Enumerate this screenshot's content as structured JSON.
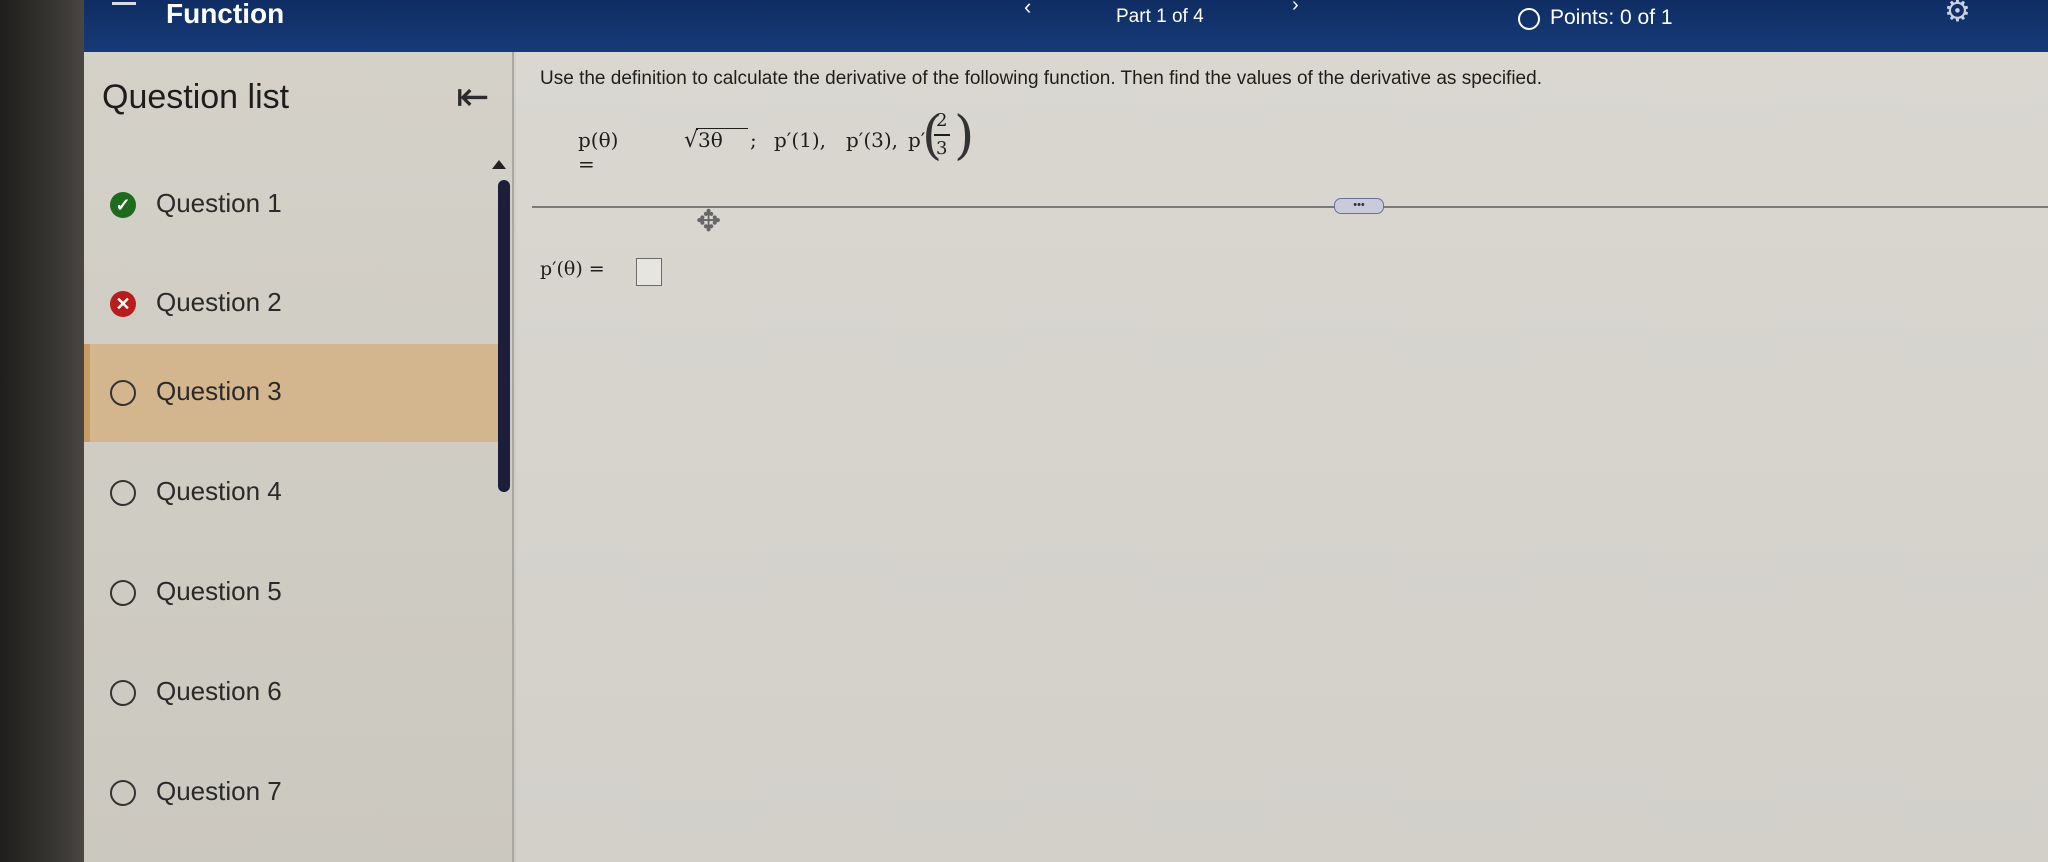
{
  "header": {
    "title": "Function",
    "part": "Part 1 of 4",
    "points": "Points: 0 of 1",
    "prev": "‹",
    "next": "›"
  },
  "sidebar": {
    "title": "Question list",
    "items": [
      {
        "label": "Question 1",
        "status": "correct"
      },
      {
        "label": "Question 2",
        "status": "incorrect"
      },
      {
        "label": "Question 3",
        "status": "current"
      },
      {
        "label": "Question 4",
        "status": "unanswered"
      },
      {
        "label": "Question 5",
        "status": "unanswered"
      },
      {
        "label": "Question 6",
        "status": "unanswered"
      },
      {
        "label": "Question 7",
        "status": "unanswered"
      }
    ]
  },
  "question": {
    "instruction": "Use the definition to calculate the derivative of the following function. Then find the values of the derivative as specified.",
    "function_lhs": "p(θ) =",
    "function_radicand": "3θ",
    "p1": "p′(1),",
    "p3": "p′(3),",
    "p23_prefix": "p′",
    "frac_num": "2",
    "frac_den": "3",
    "answer_label": "p′(θ) ="
  },
  "colors": {
    "header_bg": "#173a78",
    "correct": "#1e6b1e",
    "incorrect": "#b81d1d",
    "active_item": "#d3b68d"
  }
}
